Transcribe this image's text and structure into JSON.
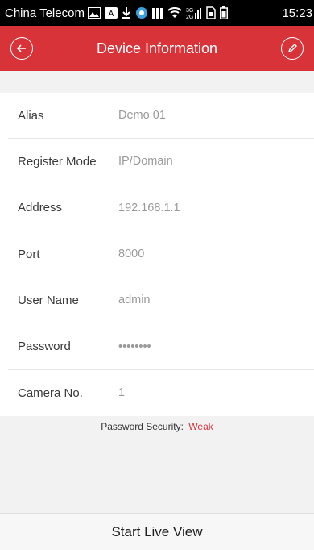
{
  "status_bar": {
    "carrier": "China Telecom",
    "time": "15:23",
    "icons": [
      "image-icon",
      "a-icon",
      "download-icon",
      "browser-icon",
      "signal-bars-icon",
      "wifi-icon",
      "network-3g-2g-icon",
      "sim-icon",
      "battery-icon"
    ]
  },
  "header": {
    "title": "Device Information",
    "accent_color": "#d9333a"
  },
  "fields": [
    {
      "label": "Alias",
      "value": "Demo 01"
    },
    {
      "label": "Register Mode",
      "value": "IP/Domain"
    },
    {
      "label": "Address",
      "value": "192.168.1.1"
    },
    {
      "label": "Port",
      "value": "8000"
    },
    {
      "label": "User Name",
      "value": "admin"
    },
    {
      "label": "Password",
      "value": "••••••••"
    },
    {
      "label": "Camera No.",
      "value": "1"
    }
  ],
  "security": {
    "label": "Password Security:",
    "level": "Weak",
    "level_color": "#d9333a"
  },
  "bottom": {
    "start_live_view": "Start Live View"
  }
}
